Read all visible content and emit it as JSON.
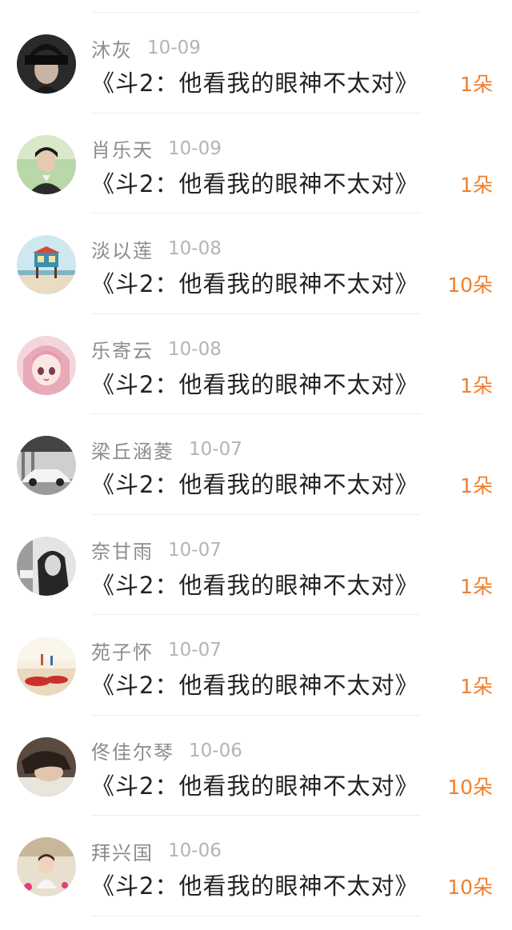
{
  "rows": [
    {
      "name": "沐灰",
      "date": "10-09",
      "gift": "《斗2：他看我的眼神不太对》",
      "count": "1朵",
      "avatar": "boy-black-cap-avatar"
    },
    {
      "name": "肖乐天",
      "date": "10-09",
      "gift": "《斗2：他看我的眼神不太对》",
      "count": "1朵",
      "avatar": "boy-green-background-avatar"
    },
    {
      "name": "淡以莲",
      "date": "10-08",
      "gift": "《斗2：他看我的眼神不太对》",
      "count": "10朵",
      "avatar": "beach-lifeguard-hut-avatar"
    },
    {
      "name": "乐寄云",
      "date": "10-08",
      "gift": "《斗2：他看我的眼神不太对》",
      "count": "1朵",
      "avatar": "anime-girl-avatar"
    },
    {
      "name": "梁丘涵菱",
      "date": "10-07",
      "gift": "《斗2：他看我的眼神不太对》",
      "count": "1朵",
      "avatar": "white-car-avatar"
    },
    {
      "name": "奈甘雨",
      "date": "10-07",
      "gift": "《斗2：他看我的眼神不太对》",
      "count": "1朵",
      "avatar": "girl-black-white-avatar"
    },
    {
      "name": "苑子怀",
      "date": "10-07",
      "gift": "《斗2：他看我的眼神不太对》",
      "count": "1朵",
      "avatar": "beach-sandals-avatar"
    },
    {
      "name": "佟佳尔琴",
      "date": "10-06",
      "gift": "《斗2：他看我的眼神不太对》",
      "count": "10朵",
      "avatar": "sleeping-girl-avatar"
    },
    {
      "name": "拜兴国",
      "date": "10-06",
      "gift": "《斗2：他看我的眼神不太对》",
      "count": "10朵",
      "avatar": "toddler-avatar"
    }
  ],
  "colors": {
    "name": "#8c8c8c",
    "date": "#b4b4b4",
    "gift": "#222222",
    "count": "#f07f2c",
    "divider": "#eeeeee"
  }
}
